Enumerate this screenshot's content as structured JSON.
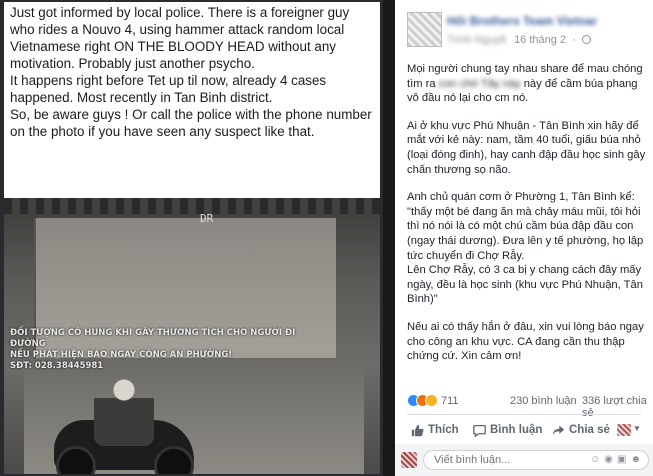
{
  "left_post": {
    "paragraphs": [
      "Just got informed by local police. There is a foreigner guy who rides a Nouvo 4, using hammer attack random local Vietnamese right ON THE BLOODY HEAD without any motivation. Probably just another psycho.",
      "It happens right before Tet up til now, already 4 cases happened. Most recently in Tan Binh district.",
      "So, be aware guys ! Or call the police with the phone number on the photo if you have seen any suspect like that."
    ],
    "photo": {
      "sign_text": "DR",
      "caption_lines": [
        "ĐỐI TƯỢNG CÔ HUNG KHI GÂY THƯƠNG TÍCH CHO NGƯỜI ĐI ĐƯỜNG",
        "NẾU PHÁT HIỆN BÁO NGAY CÔNG AN PHƯỜNG!",
        "SĐT: 028.38445981"
      ]
    }
  },
  "right_post": {
    "page_name": "Hội Brothers Team Vietnam",
    "author": "Trinh Nguyễn",
    "date": "16 tháng 2",
    "dot": "·",
    "globe_icon": "globe-icon",
    "paragraphs": [
      {
        "pre": "Mọi người chung tay nhau share để mau chóng tìm ra ",
        "blur": "con chó Tây này",
        "post": " này để cầm búa phang vô đầu nó lại cho cm nó."
      },
      {
        "text": "Ai ở khu vực Phú Nhuận - Tân Bình xin hãy để mắt với kẻ này: nam, tầm 40 tuổi, giấu búa nhỏ (loại đóng đinh), hay canh đập đầu học sinh gây chấn thương sọ não."
      },
      {
        "text": "Anh chủ quán cơm ở Phường 1, Tân Bình kể: \"thấy một bé đang ăn mà chảy máu mũi, tôi hỏi thì nó nói là có một chú cầm búa đập đầu con (ngay thái dương). Đưa lên y tế phường, họ lập tức chuyển đi Chợ Rẫy.\nLên Chợ Rẫy, có 3 ca bị y chang cách đây mấy ngày, đều là học sinh (khu vực Phú Nhuận, Tân Bình)\""
      },
      {
        "text": "Nếu ai có thấy hắn ở đâu, xin vui lòng báo ngay cho công an khu vực. CA đang cần thu thập chứng cứ. Xin cảm ơn!"
      }
    ],
    "reactions": {
      "count": "711",
      "comments": "230 bình luận",
      "shares": "336 lượt chia sẻ",
      "colors": {
        "like": "#2d88ff",
        "angry": "#e9710f",
        "sad": "#f7b125"
      }
    },
    "actions": {
      "like": "Thích",
      "comment": "Bình luận",
      "share": "Chia sẻ"
    },
    "comment_box": {
      "placeholder": "Viết bình luận..."
    }
  }
}
